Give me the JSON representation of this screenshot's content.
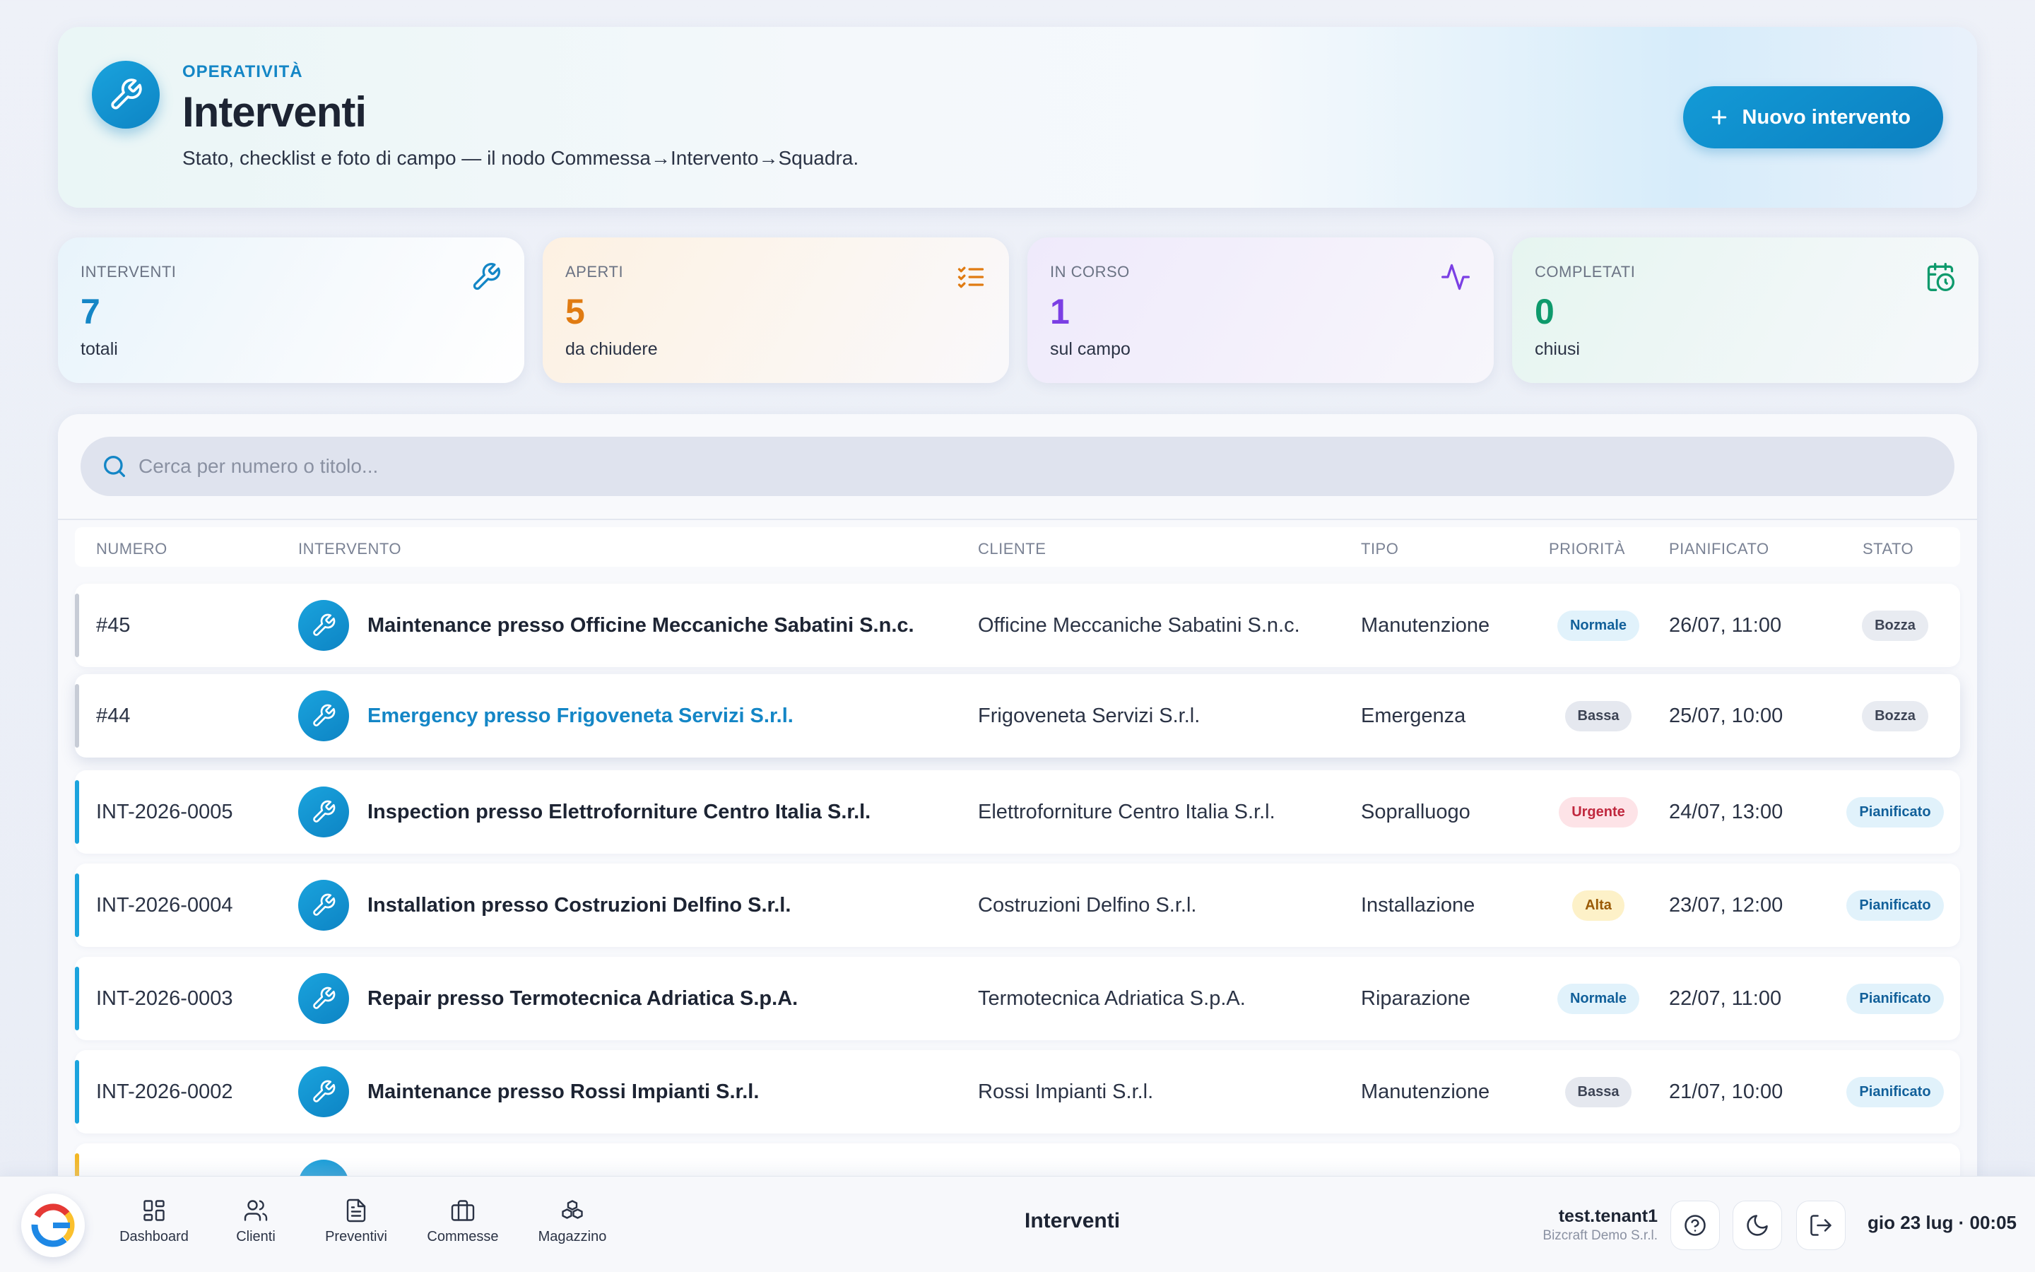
{
  "header": {
    "eyebrow": "OPERATIVITÀ",
    "title": "Interventi",
    "subtitle": "Stato, checklist e foto di campo — il nodo Commessa→Intervento→Squadra.",
    "new_button_label": "Nuovo intervento",
    "header_icon": "wrench-icon"
  },
  "stats": [
    {
      "label": "INTERVENTI",
      "value": "7",
      "sub": "totali",
      "color": "#1486c6",
      "icon": "wrench-icon"
    },
    {
      "label": "APERTI",
      "value": "5",
      "sub": "da chiudere",
      "color": "#e07b12",
      "icon": "checklist-icon"
    },
    {
      "label": "IN CORSO",
      "value": "1",
      "sub": "sul campo",
      "color": "#7b3fe4",
      "icon": "activity-icon"
    },
    {
      "label": "COMPLETATI",
      "value": "0",
      "sub": "chiusi",
      "color": "#0e9a6c",
      "icon": "calendar-clock-icon"
    }
  ],
  "search": {
    "placeholder": "Cerca per numero o titolo..."
  },
  "table": {
    "columns": [
      "NUMERO",
      "INTERVENTO",
      "CLIENTE",
      "TIPO",
      "PRIORITÀ",
      "PIANIFICATO",
      "STATO"
    ],
    "rows": [
      {
        "numero": "#45",
        "intervento": "Maintenance presso Officine Meccaniche Sabatini S.n.c.",
        "cliente": "Officine Meccaniche Sabatini S.n.c.",
        "tipo": "Manutenzione",
        "priorita": "Normale",
        "pianificato": "26/07, 11:00",
        "stato": "Bozza"
      },
      {
        "numero": "#44",
        "intervento": "Emergency presso Frigoveneta Servizi S.r.l.",
        "cliente": "Frigoveneta Servizi S.r.l.",
        "tipo": "Emergenza",
        "priorita": "Bassa",
        "pianificato": "25/07, 10:00",
        "stato": "Bozza"
      },
      {
        "numero": "INT-2026-0005",
        "intervento": "Inspection presso Elettroforniture Centro Italia S.r.l.",
        "cliente": "Elettroforniture Centro Italia S.r.l.",
        "tipo": "Sopralluogo",
        "priorita": "Urgente",
        "pianificato": "24/07, 13:00",
        "stato": "Pianificato"
      },
      {
        "numero": "INT-2026-0004",
        "intervento": "Installation presso Costruzioni Delfino S.r.l.",
        "cliente": "Costruzioni Delfino S.r.l.",
        "tipo": "Installazione",
        "priorita": "Alta",
        "pianificato": "23/07, 12:00",
        "stato": "Pianificato"
      },
      {
        "numero": "INT-2026-0003",
        "intervento": "Repair presso Termotecnica Adriatica S.p.A.",
        "cliente": "Termotecnica Adriatica S.p.A.",
        "tipo": "Riparazione",
        "priorita": "Normale",
        "pianificato": "22/07, 11:00",
        "stato": "Pianificato"
      },
      {
        "numero": "INT-2026-0002",
        "intervento": "Maintenance presso Rossi Impianti S.r.l.",
        "cliente": "Rossi Impianti S.r.l.",
        "tipo": "Manutenzione",
        "priorita": "Bassa",
        "pianificato": "21/07, 10:00",
        "stato": "Pianificato"
      }
    ]
  },
  "dock": {
    "nav": [
      {
        "label": "Dashboard",
        "icon": "dashboard-icon"
      },
      {
        "label": "Clienti",
        "icon": "users-icon"
      },
      {
        "label": "Preventivi",
        "icon": "document-icon"
      },
      {
        "label": "Commesse",
        "icon": "briefcase-icon"
      },
      {
        "label": "Magazzino",
        "icon": "boxes-icon"
      }
    ],
    "current_page": "Interventi",
    "user_name": "test.tenant1",
    "user_org": "Bizcraft Demo S.r.l.",
    "clock": "gio 23 lug · 00:05"
  },
  "colors": {
    "accent": "#1486c6",
    "bar_bozza": "#c7ccd6",
    "bar_pianificato": "#1aa3dd",
    "bar_hidden": "#f2b624"
  }
}
